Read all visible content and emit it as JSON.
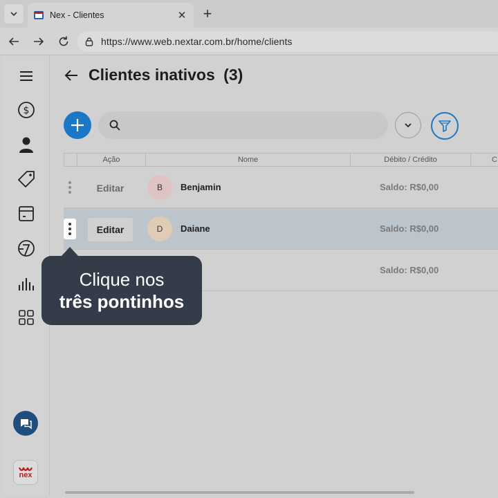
{
  "browser": {
    "tab_title": "Nex - Clientes",
    "url": "https://www.web.nextar.com.br/home/clients"
  },
  "sidebar": {
    "items": [
      {
        "icon": "menu-icon"
      },
      {
        "icon": "dollar-icon"
      },
      {
        "icon": "person-icon"
      },
      {
        "icon": "tag-icon"
      },
      {
        "icon": "box-icon"
      },
      {
        "icon": "chart-pie-icon"
      },
      {
        "icon": "bar-chart-icon"
      },
      {
        "icon": "grid-icon"
      }
    ],
    "logo_text": "nex"
  },
  "page": {
    "title": "Clientes inativos",
    "count": "(3)"
  },
  "search": {
    "placeholder": ""
  },
  "table": {
    "columns": [
      "Ação",
      "Nome",
      "Débito / Crédito",
      "C"
    ],
    "rows": [
      {
        "edit": "Editar",
        "initial": "B",
        "name": "Benjamin",
        "saldo": "Saldo: R$0,00",
        "avatar_color": "#dfc2c2"
      },
      {
        "edit": "Editar",
        "initial": "D",
        "name": "Daiane",
        "saldo": "Saldo: R$0,00",
        "avatar_color": "#e0cbb4"
      },
      {
        "edit": "",
        "initial": "",
        "name": "",
        "saldo": "Saldo: R$0,00",
        "avatar_color": ""
      }
    ]
  },
  "tooltip": {
    "line1": "Clique nos",
    "line2": "três pontinhos"
  },
  "colors": {
    "accent": "#1a78c7",
    "tooltip_bg": "#343c4a",
    "selected_row": "#bcc4cc"
  }
}
